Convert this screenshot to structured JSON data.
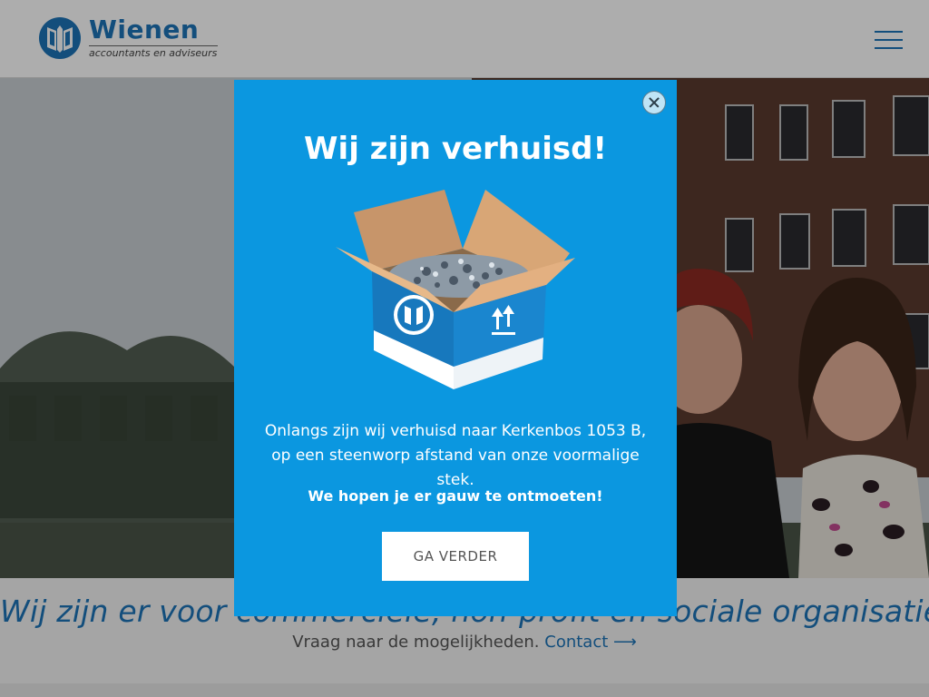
{
  "header": {
    "logo_name": "Wienen",
    "logo_tagline": "accountants en adviseurs"
  },
  "main": {
    "headline": "Wij zijn er voor commerciële, non-profit en sociale organisaties",
    "subline_text": "Vraag naar de mogelijkheden.",
    "contact_link": "Contact ⟶"
  },
  "modal": {
    "title": "Wij zijn verhuisd!",
    "body": "Onlangs zijn wij verhuisd naar Kerkenbos 1053 B, op een steenworp afstand van onze voormalige stek.",
    "emphasis": "We hopen je er gauw te ontmoeten!",
    "button_label": "GA VERDER"
  },
  "colors": {
    "brand_blue": "#1c73b7",
    "modal_blue": "#0b97e0",
    "button_bg": "#ffffff"
  },
  "icons": [
    "wienen-logo-icon",
    "hamburger-menu-icon",
    "close-icon",
    "moving-box-illustration",
    "this-side-up-icon"
  ]
}
